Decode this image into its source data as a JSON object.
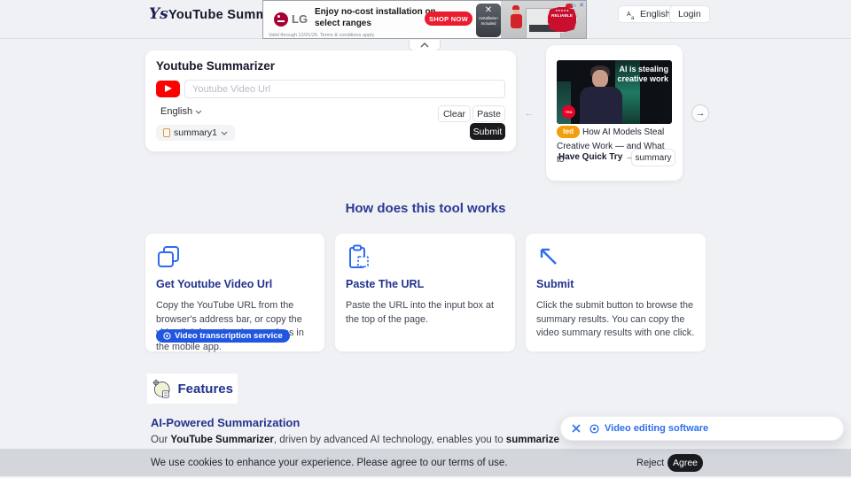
{
  "header": {
    "logo_glyph": "Ys",
    "title": "YouTube Summarizer",
    "language_label": "English",
    "login_label": "Login"
  },
  "ad": {
    "brand": "LG",
    "headline": "Enjoy no-cost installation on select ranges",
    "cta": "SHOP NOW",
    "badge_icon": "✕",
    "badge_label": "Installation Included",
    "ribbon_stars": "★★★★★",
    "ribbon_word": "RELIABLE",
    "fine_print": "Valid through 12/31/25. Terms & conditions apply.",
    "adchoices_icon": "▷",
    "close_icon": "✕"
  },
  "summarizer": {
    "title": "Youtube Summarizer",
    "url_placeholder": "Youtube Video Url",
    "language_value": "English",
    "clear_label": "Clear",
    "paste_label": "Paste",
    "summary_value": "summary1",
    "submit_label": "Submit"
  },
  "carousel": {
    "thumb_caption": "AI is stealing creative work",
    "thumb_logo": "TED",
    "badge": "ted",
    "video_title_line1": "How AI Models Steal",
    "video_title_line2": "Creative Work — and What to",
    "quick_try_label": "Have Quick Try",
    "quick_try_arrow": "→",
    "summary_label": "summary",
    "prev_arrow": "←",
    "next_arrow": "→"
  },
  "how_it_works": {
    "title": "How does this tool works",
    "cards": [
      {
        "title": "Get Youtube Video Url",
        "text": "Copy the YouTube URL from the browser's address bar, or copy the video link from the share options in the mobile app.",
        "badge": "Video transcription service"
      },
      {
        "title": "Paste The URL",
        "text": "Paste the URL into the input box at the top of the page."
      },
      {
        "title": "Submit",
        "text": "Click the submit button to browse the summary results. You can copy the video summary results with one click."
      }
    ]
  },
  "features": {
    "title": "Features",
    "subtitle": "AI-Powered Summarization",
    "body_prefix": "Our ",
    "body_bold1": "YouTube Summarizer",
    "body_mid": ", driven by advanced AI technology, enables you to ",
    "body_bold2": "summarize"
  },
  "tooltip": {
    "label": "Video editing software"
  },
  "cookie": {
    "message": "We use cookies to enhance your experience. Please agree to our terms of use.",
    "reject_label": "Reject",
    "agree_label": "Agree"
  },
  "colors": {
    "accent_navy": "#23338c",
    "badge_blue": "#2156e0",
    "youtube_red": "#fd0000",
    "lg_red": "#a50034",
    "cta_red": "#ea1c2d",
    "ted_orange": "#f59e0b",
    "dark_button": "#1a1b1f"
  }
}
